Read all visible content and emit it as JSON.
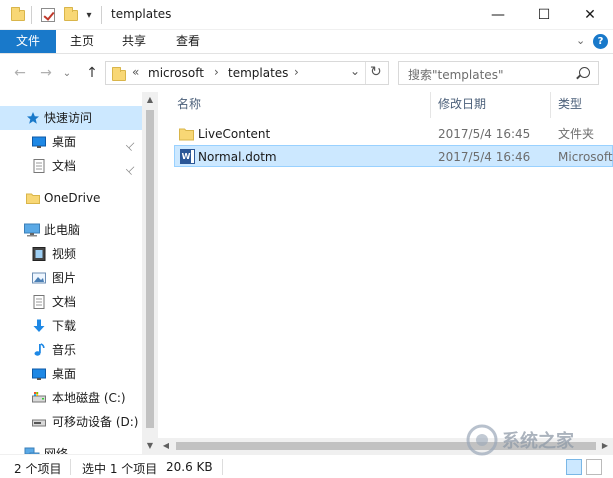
{
  "window": {
    "title": "templates",
    "minimize_glyph": "—",
    "maximize_glyph": "☐",
    "close_glyph": "✕",
    "quick_access_dropdown": "▾"
  },
  "ribbon": {
    "tabs": [
      {
        "label": "文件",
        "active": true
      },
      {
        "label": "主页"
      },
      {
        "label": "共享"
      },
      {
        "label": "查看"
      }
    ],
    "expand_glyph": "⌄",
    "help_glyph": "?"
  },
  "address": {
    "back_glyph": "←",
    "forward_glyph": "→",
    "recent_glyph": "⌄",
    "up_glyph": "↑",
    "overflow": "«",
    "crumbs": [
      "microsoft",
      "templates"
    ],
    "crumb_sep": "›",
    "dropdown_glyph": "⌄",
    "refresh_glyph": "↻",
    "search_placeholder": "搜索\"templates\""
  },
  "navpane": {
    "items": [
      {
        "label": "快速访问",
        "icon": "star-icon",
        "pinned": false,
        "selected": true
      },
      {
        "label": "桌面",
        "icon": "desktop-icon",
        "pinned": true
      },
      {
        "label": "文档",
        "icon": "documents-icon",
        "pinned": true
      },
      {
        "label": "OneDrive",
        "icon": "folder-icon",
        "pinned": false
      },
      {
        "label": "此电脑",
        "icon": "computer-icon",
        "pinned": false
      },
      {
        "label": "视频",
        "icon": "video-icon",
        "pinned": false
      },
      {
        "label": "图片",
        "icon": "pictures-icon",
        "pinned": false
      },
      {
        "label": "文档",
        "icon": "documents-icon",
        "pinned": false
      },
      {
        "label": "下载",
        "icon": "download-icon",
        "pinned": false
      },
      {
        "label": "音乐",
        "icon": "music-icon",
        "pinned": false
      },
      {
        "label": "桌面",
        "icon": "desktop-icon",
        "pinned": false
      },
      {
        "label": "本地磁盘 (C:)",
        "icon": "drive-icon",
        "pinned": false
      },
      {
        "label": "可移动设备 (D:)",
        "icon": "usb-drive-icon",
        "pinned": false
      },
      {
        "label": "网络",
        "icon": "network-icon",
        "pinned": false
      }
    ],
    "pin_glyph": "📌"
  },
  "files": {
    "columns": {
      "name": "名称",
      "modified": "修改日期",
      "type": "类型"
    },
    "sort_glyph": "^",
    "rows": [
      {
        "name": "LiveContent",
        "modified": "2017/5/4 16:45",
        "type": "文件夹",
        "icon": "folder-icon",
        "selected": false
      },
      {
        "name": "Normal.dotm",
        "modified": "2017/5/4 16:46",
        "type": "Microsoft",
        "icon": "word-template-icon",
        "selected": true
      }
    ]
  },
  "status": {
    "item_count": "2 个项目",
    "selected": "选中 1 个项目",
    "size": "20.6 KB"
  },
  "watermark": {
    "text": "系统之家"
  },
  "colors": {
    "accent": "#1979ca",
    "selection": "#cce8ff",
    "folder": "#f8d775"
  }
}
